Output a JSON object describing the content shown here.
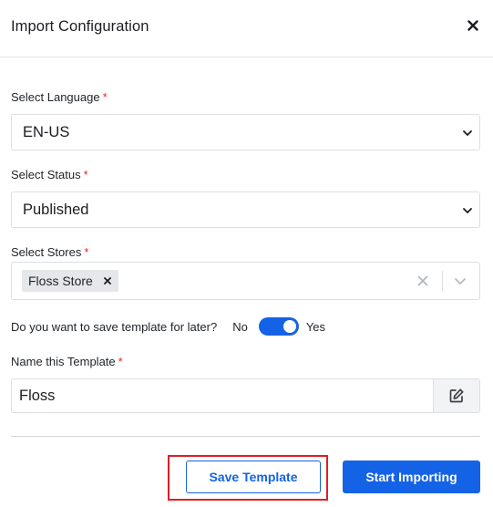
{
  "modal": {
    "title": "Import Configuration"
  },
  "language": {
    "label": "Select Language",
    "required_mark": "*",
    "value": "EN-US"
  },
  "status": {
    "label": "Select Status",
    "required_mark": "*",
    "value": "Published"
  },
  "stores": {
    "label": "Select Stores",
    "required_mark": "*",
    "selected": [
      "Floss Store"
    ]
  },
  "save_template_toggle": {
    "question": "Do you want to save template for later?",
    "off_label": "No",
    "on_label": "Yes",
    "enabled": true
  },
  "template_name": {
    "label": "Name this Template",
    "required_mark": "*",
    "value": "Floss"
  },
  "actions": {
    "save_template_label": "Save Template",
    "start_importing_label": "Start Importing"
  },
  "icons": {
    "close": "close-icon",
    "select_chevron": "chevron-down-icon",
    "chip_remove": "close-icon",
    "clear": "clear-icon",
    "edit": "edit-icon"
  },
  "colors": {
    "accent": "#1463e6",
    "required": "#e5262a",
    "highlight": "#e01e26"
  }
}
